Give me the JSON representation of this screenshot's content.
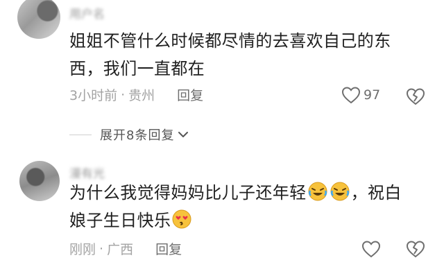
{
  "comments": [
    {
      "username": "用户名",
      "text_line1": "姐姐不管什么时候都尽情的去喜欢自己的东",
      "text_line2": "西，我们一直都在",
      "time": "3小时前",
      "location": "贵州",
      "reply_label": "回复",
      "like_count": "97"
    },
    {
      "username": "漫有光",
      "text_line1_a": "为什么我觉得妈妈比儿子还年轻",
      "text_line1_b": "，祝白",
      "text_line2": "娘子生日快乐",
      "time": "刚刚",
      "location": "广西",
      "reply_label": "回复"
    }
  ],
  "expand_replies": {
    "label": "展开8条回复"
  },
  "meta_separator": "·",
  "icons": {
    "like": "heart-outline-icon",
    "dislike": "broken-heart-icon",
    "expand": "chevron-down-icon",
    "emoji_laugh": "rolling-laughing-emoji",
    "emoji_kiss": "heart-eyes-kiss-emoji"
  },
  "colors": {
    "text": "#1f1f1f",
    "meta": "#a3a3a3",
    "icon": "#6e6e6e",
    "emoji_yellow": "#f7c23c"
  }
}
